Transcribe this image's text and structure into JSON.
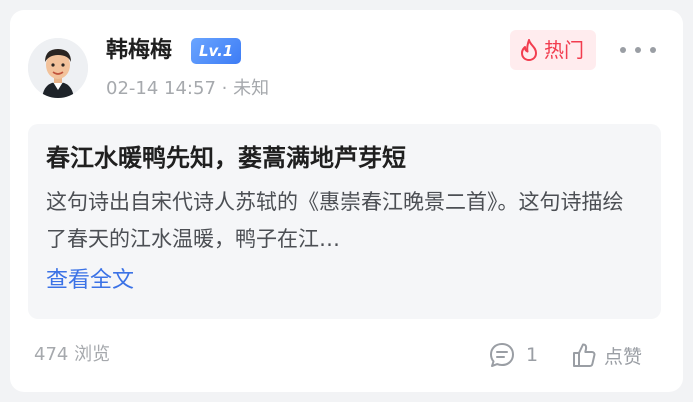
{
  "author": {
    "name": "韩梅梅",
    "level": "Lv.1",
    "timestamp": "02-14 14:57",
    "location_sep": " · ",
    "location": "未知"
  },
  "tag": {
    "label": "热门",
    "icon": "flame-icon",
    "color": "#f23d4f"
  },
  "post": {
    "title": "春江水暖鸭先知，蒌蒿满地芦芽短",
    "excerpt": "这句诗出自宋代诗人苏轼的《惠崇春江晚景二首》。这句诗描绘了春天的江水温暖，鸭子在江…",
    "read_more": "查看全文"
  },
  "footer": {
    "views": "474 浏览",
    "comments": "1",
    "like_label": "点赞"
  },
  "colors": {
    "accent": "#3b72e6",
    "level_badge": "#3d7cf5"
  }
}
